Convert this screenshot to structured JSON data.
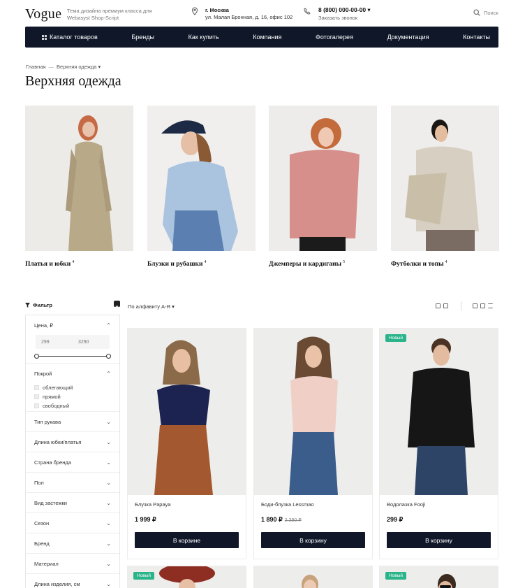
{
  "header": {
    "logo": "Vogue",
    "tagline_line1": "Тема дизайна премиум класса для",
    "tagline_line2": "Webasyst Shop-Script",
    "city": "г. Москва",
    "address": "ул. Малая Бронная, д. 16, офис 102",
    "phone": "8 (800) 000-00-00",
    "callback": "Заказать звонок",
    "search": "Поиск"
  },
  "nav": {
    "items": [
      "Каталог товаров",
      "Бренды",
      "Как купить",
      "Компания",
      "Фотогалерея",
      "Документация",
      "Контакты"
    ]
  },
  "breadcrumb": {
    "home": "Главная",
    "sep": "—",
    "current": "Верхняя одежда"
  },
  "page_title": "Верхняя одежда",
  "categories": [
    {
      "label": "Платья и юбки",
      "count": "4"
    },
    {
      "label": "Блузки и рубашки",
      "count": "4"
    },
    {
      "label": "Джемперы и кардиганы",
      "count": "5"
    },
    {
      "label": "Футболки и топы",
      "count": "4"
    }
  ],
  "filter": {
    "title": "Фильтр",
    "price_label": "Цена, ₽",
    "price_min": "299",
    "price_max": "3290",
    "cut_label": "Покрой",
    "cut_options": [
      "облегающий",
      "прямой",
      "свободный"
    ],
    "sections": [
      "Тип рукава",
      "Длина юбки/платья",
      "Страна бренда",
      "Пол",
      "Вид застежки",
      "Сезон",
      "Бренд",
      "Материал",
      "Длина изделия, см"
    ]
  },
  "sort": {
    "label": "По алфавиту А-Я"
  },
  "products": [
    {
      "name": "Блузка Papaya",
      "price": "1 999 ₽",
      "old_price": "",
      "button": "В корзине",
      "badge": ""
    },
    {
      "name": "Боди-блузка Lessmao",
      "price": "1 890 ₽",
      "old_price": "2 390 ₽",
      "button": "В корзину",
      "badge": ""
    },
    {
      "name": "Водолазка Fooji",
      "price": "299 ₽",
      "old_price": "",
      "button": "В корзину",
      "badge": "Новый"
    }
  ],
  "row2_badges": [
    "Новый",
    "",
    "Новый"
  ],
  "colors": {
    "nav_bg": "#0f1729",
    "badge": "#2bb38a",
    "button": "#0f1729"
  }
}
